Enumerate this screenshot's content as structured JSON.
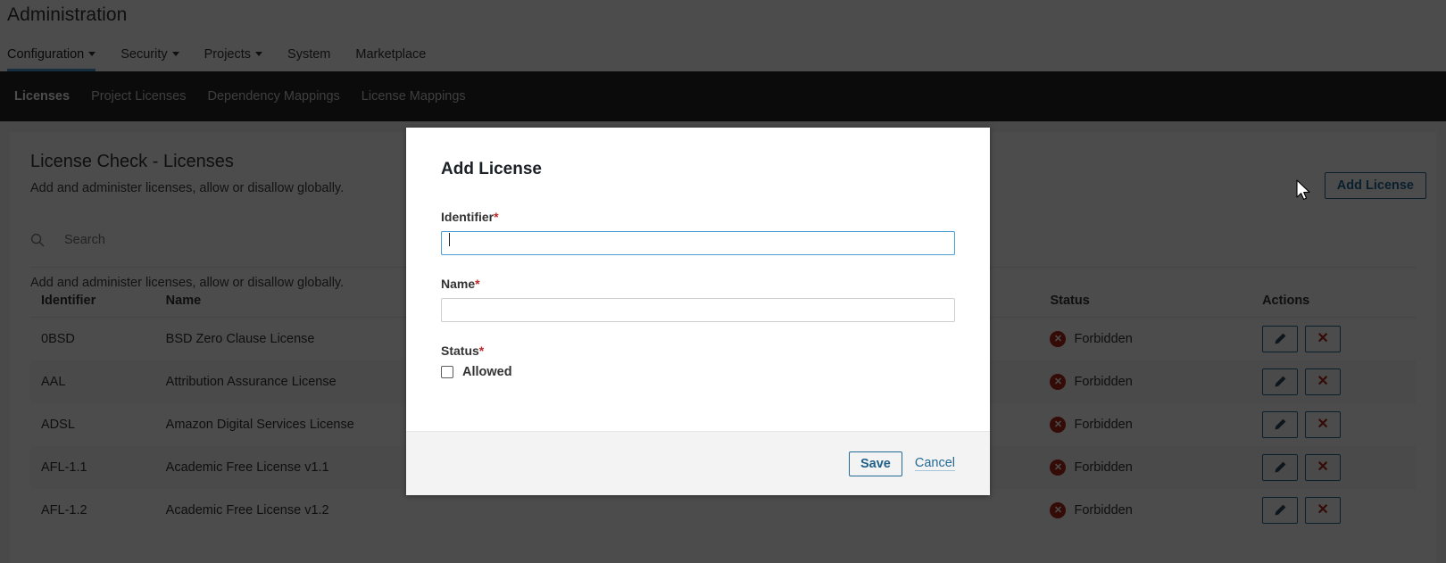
{
  "header": {
    "app_title": "Administration",
    "nav": [
      {
        "label": "Configuration",
        "has_caret": true,
        "active": true
      },
      {
        "label": "Security",
        "has_caret": true,
        "active": false
      },
      {
        "label": "Projects",
        "has_caret": true,
        "active": false
      },
      {
        "label": "System",
        "has_caret": false,
        "active": false
      },
      {
        "label": "Marketplace",
        "has_caret": false,
        "active": false
      }
    ]
  },
  "subnav": {
    "items": [
      {
        "label": "Licenses",
        "active": true
      },
      {
        "label": "Project Licenses",
        "active": false
      },
      {
        "label": "Dependency Mappings",
        "active": false
      },
      {
        "label": "License Mappings",
        "active": false
      }
    ]
  },
  "page": {
    "title": "License Check - Licenses",
    "subtitle": "Add and administer licenses, allow or disallow globally.",
    "add_button": "Add License",
    "table_caption": "Add and administer licenses, allow or disallow globally."
  },
  "search": {
    "placeholder": "Search",
    "value": "",
    "icon": "search-icon"
  },
  "table": {
    "columns": [
      "Identifier",
      "Name",
      "Status",
      "Actions"
    ],
    "rows": [
      {
        "identifier": "0BSD",
        "name": "BSD Zero Clause License",
        "status": "Forbidden"
      },
      {
        "identifier": "AAL",
        "name": "Attribution Assurance License",
        "status": "Forbidden"
      },
      {
        "identifier": "ADSL",
        "name": "Amazon Digital Services License",
        "status": "Forbidden"
      },
      {
        "identifier": "AFL-1.1",
        "name": "Academic Free License v1.1",
        "status": "Forbidden"
      },
      {
        "identifier": "AFL-1.2",
        "name": "Academic Free License v1.2",
        "status": "Forbidden"
      }
    ],
    "action_icons": [
      "pencil-icon",
      "delete-x-icon"
    ]
  },
  "modal": {
    "title": "Add License",
    "identifier_label": "Identifier",
    "identifier_value": "",
    "identifier_required": "*",
    "name_label": "Name",
    "name_value": "",
    "name_required": "*",
    "status_label": "Status",
    "status_required": "*",
    "allowed_label": "Allowed",
    "allowed_checked": false,
    "save_label": "Save",
    "cancel_label": "Cancel"
  },
  "colors": {
    "accent_blue": "#4b9fd5",
    "link_blue": "#236a97",
    "forbidden_red": "#b0251a",
    "required_red": "#bd2626",
    "subnav_dark": "#262626",
    "page_bg": "#f3f3f3"
  }
}
